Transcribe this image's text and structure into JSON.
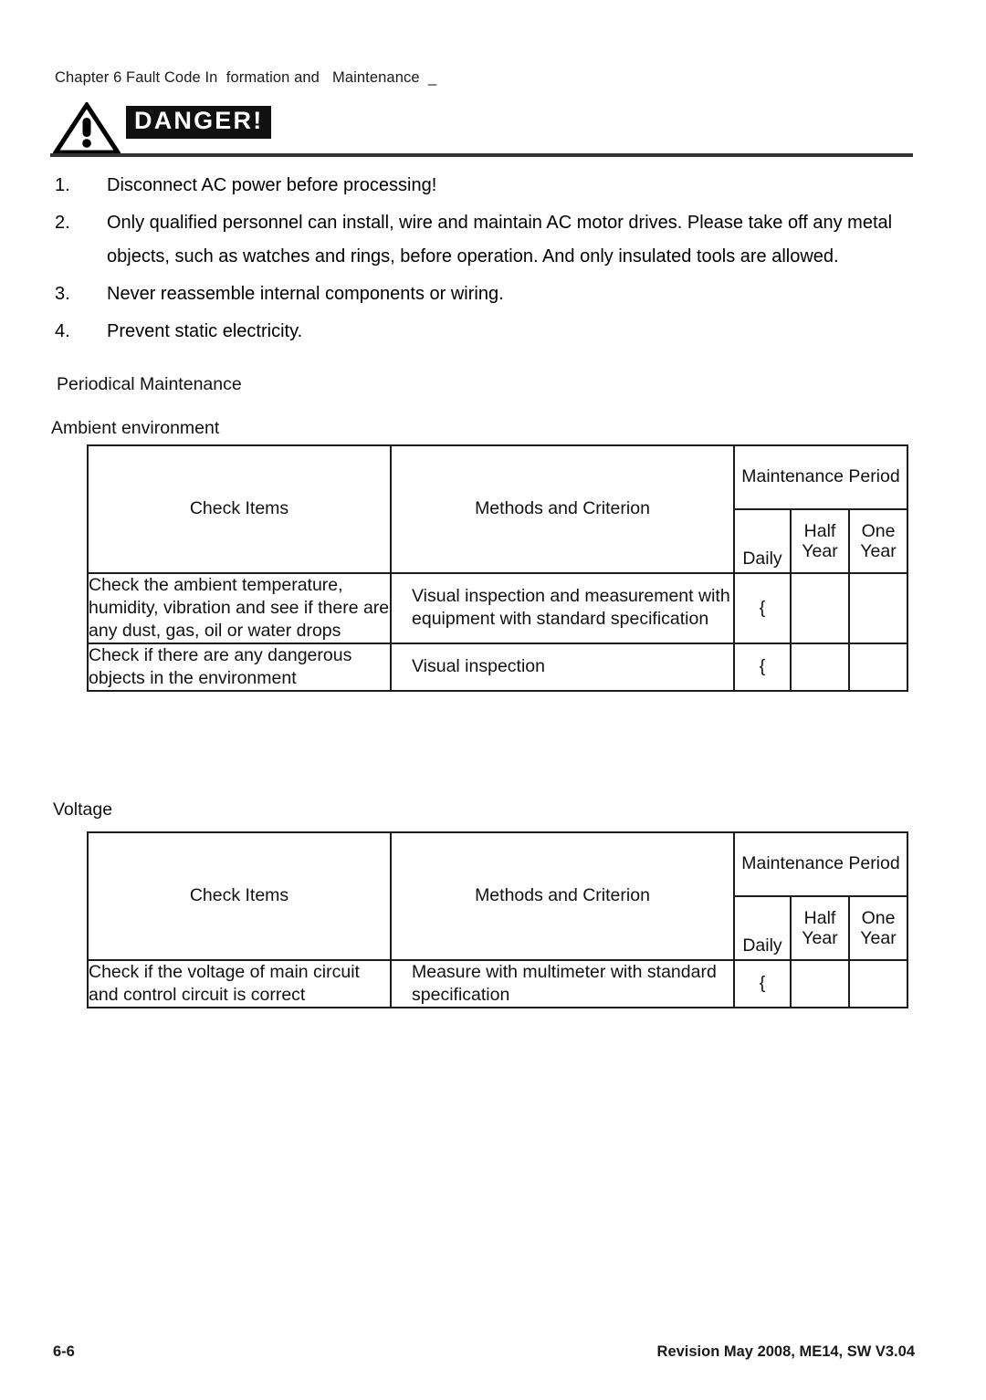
{
  "header": {
    "running_head": "Chapter 6 Fault Code In  formation and   Maintenance  _"
  },
  "danger_banner": {
    "label": "DANGER!",
    "triangle_icon": "warning-triangle-icon",
    "accent_color": "#111111"
  },
  "danger_list": [
    {
      "num": "1.",
      "text": "Disconnect AC power before processing!"
    },
    {
      "num": "2.",
      "text": "Only qualified personnel can install, wire and maintain AC motor drives. Please take off any metal objects, such as watches and rings, before operation. And only insulated tools are allowed."
    },
    {
      "num": "3.",
      "text": "Never reassemble internal components or wiring."
    },
    {
      "num": "4.",
      "text": "Prevent static electricity."
    }
  ],
  "sections": {
    "periodical_maintenance": "Periodical Maintenance",
    "ambient_environment": "Ambient environment",
    "voltage": "Voltage"
  },
  "table_headers": {
    "check_items": "Check Items",
    "methods_and_criterion": "Methods and Criterion",
    "maintenance_period": "Maintenance Period",
    "daily": "Daily",
    "half_year": "Half Year",
    "one_year": "One Year"
  },
  "tables": {
    "ambient": {
      "rows": [
        {
          "check_item": "Check the ambient temperature, humidity, vibration and see if there are any dust, gas, oil or water drops",
          "method": "Visual inspection and measurement with equipment with standard specification",
          "daily": "{",
          "half_year": "",
          "one_year": ""
        },
        {
          "check_item": "Check if there are any dangerous objects in the environment",
          "method": "Visual inspection",
          "daily": "{",
          "half_year": "",
          "one_year": ""
        }
      ]
    },
    "voltage": {
      "rows": [
        {
          "check_item": "Check if the voltage of main circuit and control circuit is correct",
          "method": "Measure with multimeter with standard specification",
          "daily": "{",
          "half_year": "",
          "one_year": ""
        }
      ]
    }
  },
  "footer": {
    "page_number": "6-6",
    "revision": "Revision May 2008, ME14, SW V3.04"
  }
}
